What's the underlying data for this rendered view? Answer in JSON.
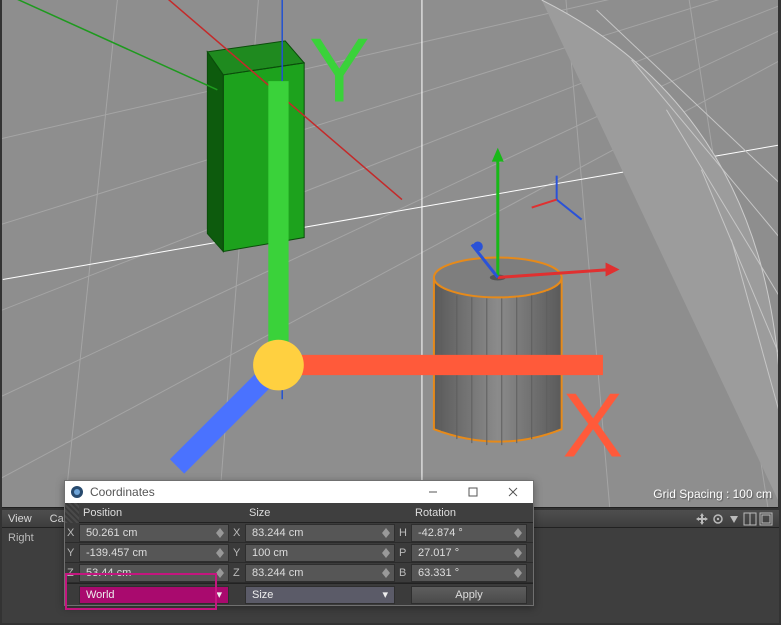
{
  "viewport": {
    "grid_spacing_label": "Grid Spacing : 100 cm"
  },
  "panel": {
    "menu": {
      "view": "View",
      "cameras": "Cameras"
    },
    "right_label": "Right"
  },
  "coord_window": {
    "title": "Coordinates",
    "columns": {
      "position": "Position",
      "size": "Size",
      "rotation": "Rotation"
    },
    "axes": {
      "x": "X",
      "y": "Y",
      "z": "Z"
    },
    "rot_axes": {
      "h": "H",
      "p": "P",
      "b": "B"
    },
    "position": {
      "x": "50.261 cm",
      "y": "-139.457 cm",
      "z": "53.44 cm"
    },
    "size": {
      "x": "83.244 cm",
      "y": "100 cm",
      "z": "83.244 cm"
    },
    "rotation": {
      "h": "-42.874 °",
      "p": "27.017 °",
      "b": "63.331 °"
    },
    "space_mode": "World",
    "size_mode": "Size",
    "apply_label": "Apply"
  }
}
